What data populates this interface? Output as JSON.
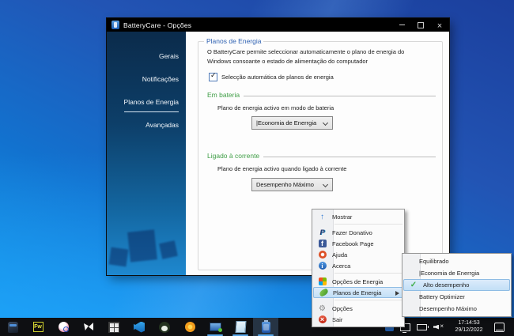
{
  "window": {
    "title": "BatteryCare - Opções",
    "controls": [
      "minimize",
      "maximize",
      "close"
    ],
    "sidebar": {
      "items": [
        {
          "label": "Gerais",
          "active": false
        },
        {
          "label": "Notificações",
          "active": false
        },
        {
          "label": "Planos de Energia",
          "active": true
        },
        {
          "label": "Avançadas",
          "active": false
        }
      ]
    },
    "content": {
      "group_title": "Planos de Energia",
      "description_line1": "O BatteryCare permite seleccionar automaticamente o plano de energia do",
      "description_line2": "Windows consoante o estado de alimentação do computador",
      "checkbox": {
        "label": "Selecção automática de planos de energia",
        "checked": true
      },
      "battery_section": {
        "title": "Em bateria",
        "description": "Plano de energia activo em modo de bateria",
        "dropdown_value": "|Economia de Enerrgia"
      },
      "ac_section": {
        "title": "Ligado à corrente",
        "description": "Plano de energia activo quando ligado à corrente",
        "dropdown_value": "Desempenho Máximo"
      }
    }
  },
  "context_menu": {
    "items": [
      {
        "label": "Mostrar",
        "icon": "up-arrow-icon"
      },
      {
        "label": "Fazer Donativo",
        "icon": "paypal-icon"
      },
      {
        "label": "Facebook Page",
        "icon": "facebook-icon"
      },
      {
        "label": "Ajuda",
        "icon": "help-ring-icon"
      },
      {
        "label": "Acerca",
        "icon": "info-icon"
      },
      {
        "label": "Opções de Energia",
        "icon": "windows-flag-icon"
      },
      {
        "label": "Planos de Energia",
        "icon": "leaf-icon",
        "has_submenu": true,
        "highlighted": true
      },
      {
        "label": "Opções",
        "icon": "gear-icon"
      },
      {
        "label": "Sair",
        "icon": "exit-icon"
      }
    ]
  },
  "submenu": {
    "items": [
      {
        "label": "Equilibrado",
        "checked": false
      },
      {
        "label": "|Economia de Enerrgia",
        "checked": false
      },
      {
        "label": "Alto desempenho",
        "checked": true,
        "highlighted": true
      },
      {
        "label": "Battery Optimizer",
        "checked": false
      },
      {
        "label": "Desempenho Máximo",
        "checked": false
      }
    ]
  },
  "taskbar": {
    "app_icons": [
      "spy-icon",
      "fireworks-icon",
      "fan-icon",
      "paw-icon",
      "grid-icon",
      "vscode-icon",
      "panda-icon",
      "orange-circle-icon",
      "monitor-app-icon",
      "notepad-icon",
      "batterycare-icon"
    ],
    "tray_icons": [
      "batterycare-tray-icon",
      "display-tray-icon",
      "battery-tray-icon",
      "volume-muted-icon",
      "action-center-icon"
    ],
    "clock_time": "17:14:53",
    "clock_date": "29/12/2022"
  }
}
